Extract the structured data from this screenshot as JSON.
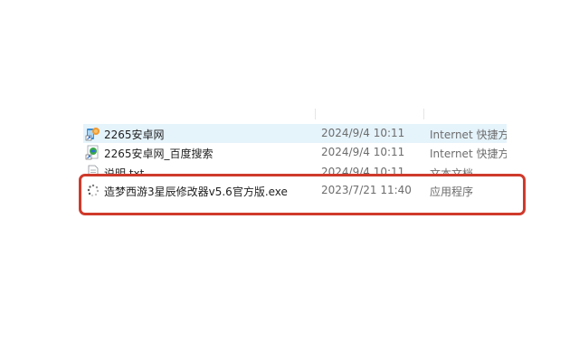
{
  "files": [
    {
      "name": "2265安卓网",
      "date": "2024/9/4 10:11",
      "type": "Internet 快捷方式",
      "icon": "internet-shortcut-icon",
      "selected": true
    },
    {
      "name": "2265安卓网_百度搜索",
      "date": "2024/9/4 10:11",
      "type": "Internet 快捷方式",
      "icon": "internet-shortcut-icon"
    },
    {
      "name": "说明.txt",
      "date": "2024/9/4 10:11",
      "type": "文本文档",
      "icon": "text-document-icon"
    },
    {
      "name": "造梦西游3星辰修改器v5.6官方版.exe",
      "date": "2023/7/21 11:40",
      "type": "应用程序",
      "icon": "application-exe-icon"
    }
  ],
  "colors": {
    "selection": "#e5f3fb",
    "highlight": "#cf3a2b",
    "secondary_text": "#6d6d6d"
  }
}
